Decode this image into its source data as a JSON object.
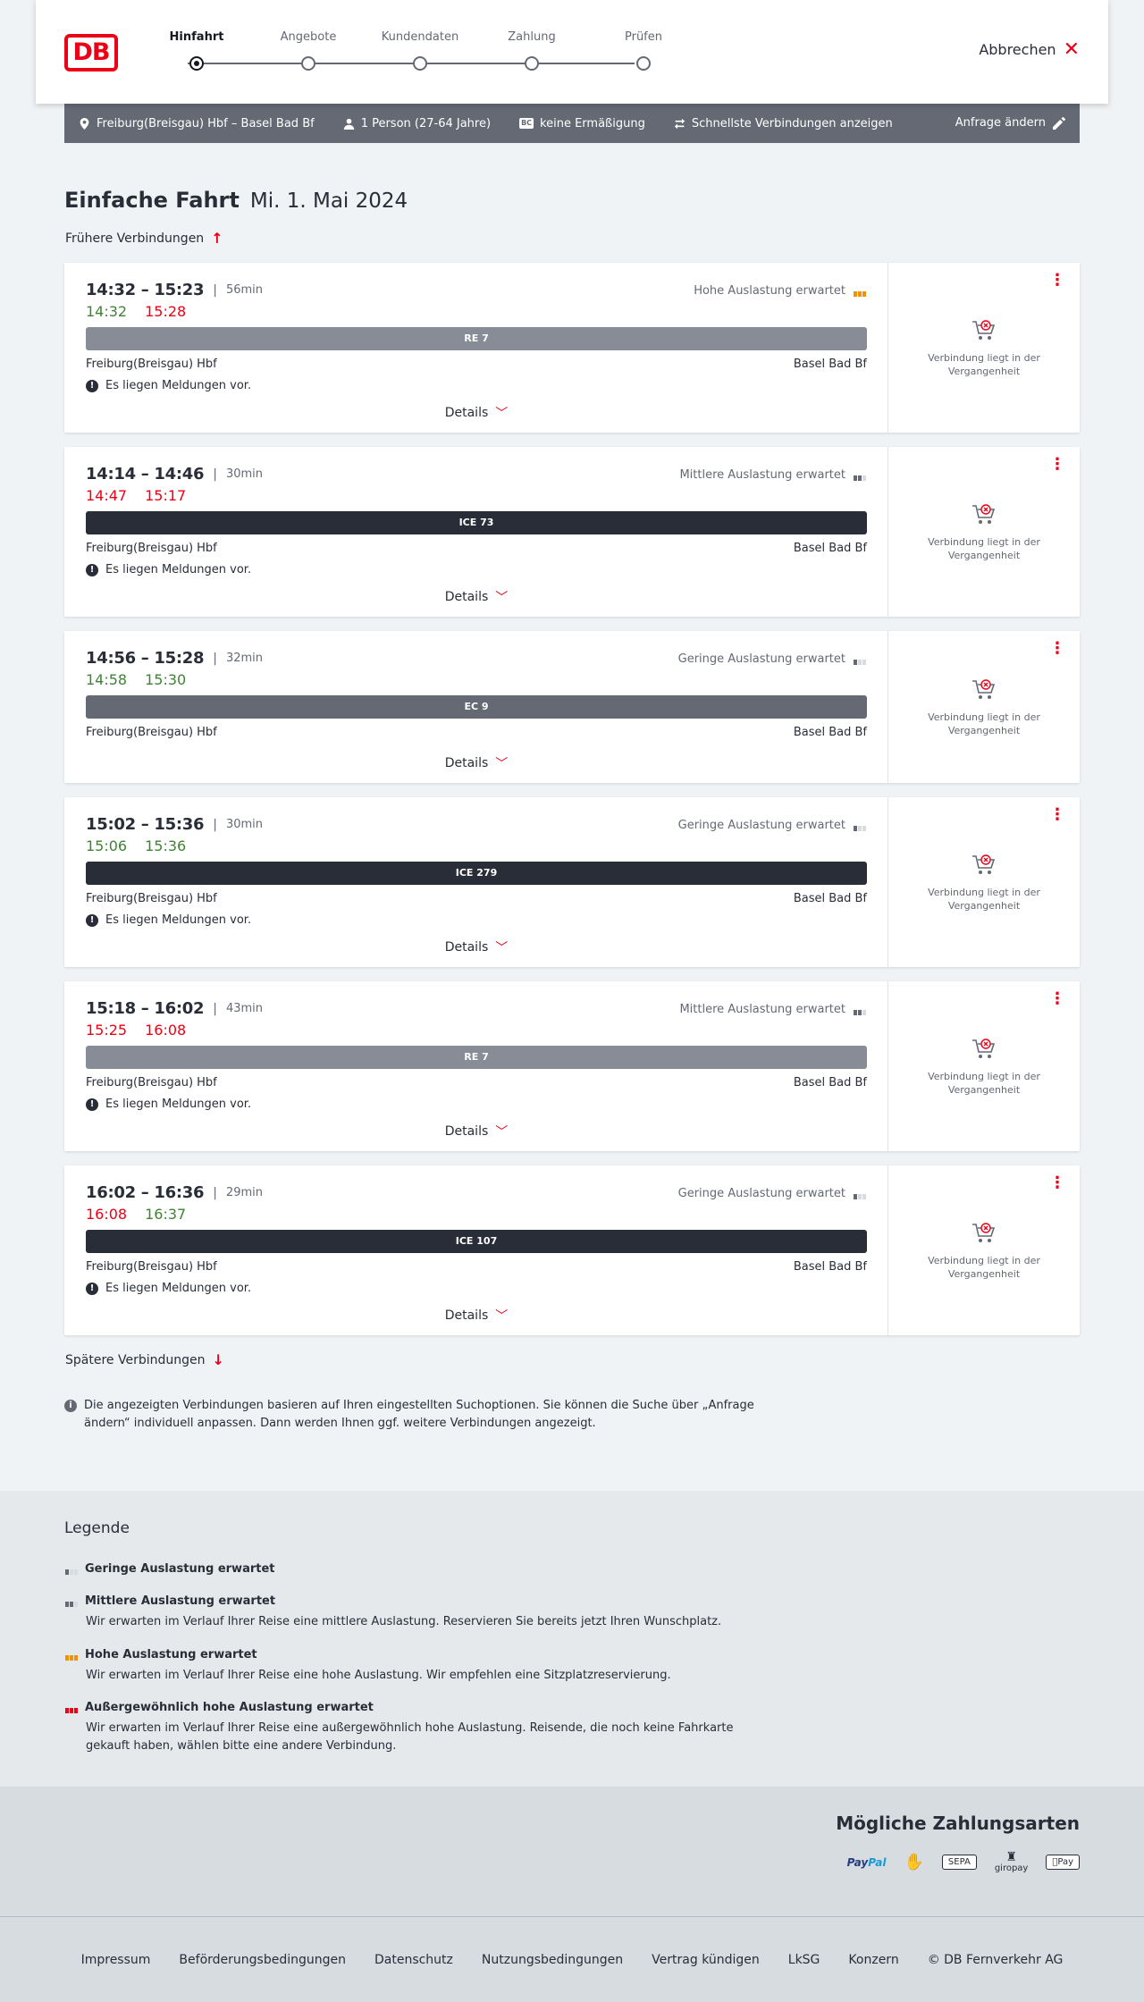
{
  "header": {
    "logo": "DB",
    "steps": [
      {
        "label": "Hinfahrt",
        "active": true
      },
      {
        "label": "Angebote",
        "active": false
      },
      {
        "label": "Kundendaten",
        "active": false
      },
      {
        "label": "Zahlung",
        "active": false
      },
      {
        "label": "Prüfen",
        "active": false
      }
    ],
    "cancel_label": "Abbrechen"
  },
  "search": {
    "route": "Freiburg(Breisgau) Hbf – Basel Bad Bf",
    "persons": "1 Person (27-64 Jahre)",
    "discount_badge": "BC",
    "discount": "keine Ermäßigung",
    "option": "Schnellste Verbindungen anzeigen",
    "change_label": "Anfrage ändern"
  },
  "title": {
    "trip_type": "Einfache Fahrt",
    "date": "Mi. 1. Mai 2024"
  },
  "earlier_label": "Frühere Verbindungen",
  "later_label": "Spätere Verbindungen",
  "connections": [
    {
      "times": "14:32 – 15:23",
      "duration": "56min",
      "rt_dep": "14:32",
      "rt_dep_status": "on-time",
      "rt_arr": "15:28",
      "rt_arr_status": "late",
      "occupancy": "Hohe Auslastung erwartet",
      "occupancy_level": "high",
      "train": "RE 7",
      "train_type": "re",
      "from": "Freiburg(Breisgau) Hbf",
      "to": "Basel Bad Bf",
      "message": "Es liegen Meldungen vor.",
      "details_label": "Details",
      "past_label": "Verbindung liegt in der Vergangenheit"
    },
    {
      "times": "14:14 – 14:46",
      "duration": "30min",
      "rt_dep": "14:47",
      "rt_dep_status": "late",
      "rt_arr": "15:17",
      "rt_arr_status": "late",
      "occupancy": "Mittlere Auslastung erwartet",
      "occupancy_level": "mid",
      "train": "ICE 73",
      "train_type": "ice",
      "from": "Freiburg(Breisgau) Hbf",
      "to": "Basel Bad Bf",
      "message": "Es liegen Meldungen vor.",
      "details_label": "Details",
      "past_label": "Verbindung liegt in der Vergangenheit"
    },
    {
      "times": "14:56 – 15:28",
      "duration": "32min",
      "rt_dep": "14:58",
      "rt_dep_status": "on-time",
      "rt_arr": "15:30",
      "rt_arr_status": "on-time",
      "occupancy": "Geringe Auslastung erwartet",
      "occupancy_level": "low",
      "train": "EC 9",
      "train_type": "ec",
      "from": "Freiburg(Breisgau) Hbf",
      "to": "Basel Bad Bf",
      "message": "",
      "details_label": "Details",
      "past_label": "Verbindung liegt in der Vergangenheit"
    },
    {
      "times": "15:02 – 15:36",
      "duration": "30min",
      "rt_dep": "15:06",
      "rt_dep_status": "on-time",
      "rt_arr": "15:36",
      "rt_arr_status": "on-time",
      "occupancy": "Geringe Auslastung erwartet",
      "occupancy_level": "low",
      "train": "ICE 279",
      "train_type": "ice",
      "from": "Freiburg(Breisgau) Hbf",
      "to": "Basel Bad Bf",
      "message": "Es liegen Meldungen vor.",
      "details_label": "Details",
      "past_label": "Verbindung liegt in der Vergangenheit"
    },
    {
      "times": "15:18 – 16:02",
      "duration": "43min",
      "rt_dep": "15:25",
      "rt_dep_status": "late",
      "rt_arr": "16:08",
      "rt_arr_status": "late",
      "occupancy": "Mittlere Auslastung erwartet",
      "occupancy_level": "mid",
      "train": "RE 7",
      "train_type": "re",
      "from": "Freiburg(Breisgau) Hbf",
      "to": "Basel Bad Bf",
      "message": "Es liegen Meldungen vor.",
      "details_label": "Details",
      "past_label": "Verbindung liegt in der Vergangenheit"
    },
    {
      "times": "16:02 – 16:36",
      "duration": "29min",
      "rt_dep": "16:08",
      "rt_dep_status": "late",
      "rt_arr": "16:37",
      "rt_arr_status": "on-time",
      "occupancy": "Geringe Auslastung erwartet",
      "occupancy_level": "low",
      "train": "ICE 107",
      "train_type": "ice",
      "from": "Freiburg(Breisgau) Hbf",
      "to": "Basel Bad Bf",
      "message": "Es liegen Meldungen vor.",
      "details_label": "Details",
      "past_label": "Verbindung liegt in der Vergangenheit"
    }
  ],
  "info_note": "Die angezeigten Verbindungen basieren auf Ihren eingestellten Suchoptionen. Sie können die Suche über „Anfrage ändern“ individuell anpassen. Dann werden Ihnen ggf. weitere Verbindungen angezeigt.",
  "legend": {
    "title": "Legende",
    "items": [
      {
        "title": "Geringe Auslastung erwartet",
        "level": "low",
        "desc": ""
      },
      {
        "title": "Mittlere Auslastung erwartet",
        "level": "mid",
        "desc": "Wir erwarten im Verlauf Ihrer Reise eine mittlere Auslastung. Reservieren Sie bereits jetzt Ihren Wunschplatz."
      },
      {
        "title": "Hohe Auslastung erwartet",
        "level": "high",
        "desc": "Wir erwarten im Verlauf Ihrer Reise eine hohe Auslastung. Wir empfehlen eine Sitzplatzreservierung."
      },
      {
        "title": "Außergewöhnlich hohe Auslastung erwartet",
        "level": "exc",
        "desc": "Wir erwarten im Verlauf Ihrer Reise eine außergewöhnlich hohe Auslastung. Reisende, die noch keine Fahrkarte gekauft haben, wählen bitte eine andere Verbindung."
      }
    ]
  },
  "payment": {
    "title": "Mögliche Zahlungsarten",
    "paypal_a": "Pay",
    "paypal_b": "Pal",
    "sepa": "SEPA",
    "giropay": "giropay",
    "applepay": "Pay"
  },
  "footer": {
    "links": [
      "Impressum",
      "Beförderungsbedingungen",
      "Datenschutz",
      "Nutzungsbedingungen",
      "Vertrag kündigen",
      "LkSG",
      "Konzern",
      "© DB Fernverkehr AG"
    ]
  },
  "colors": {
    "accent": "#ec0016",
    "on_time": "#408335",
    "late": "#ec0016",
    "high_occupancy": "#f39200"
  }
}
